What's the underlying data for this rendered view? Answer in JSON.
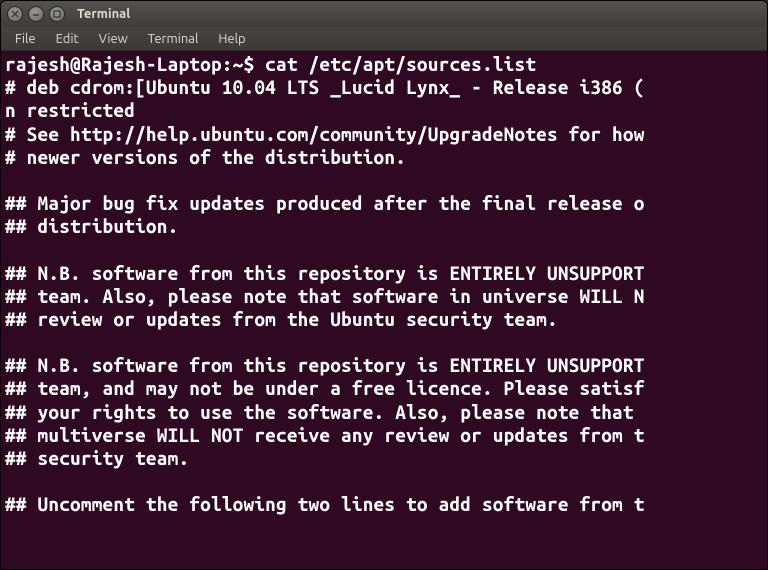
{
  "window": {
    "title": "Terminal"
  },
  "menubar": {
    "items": [
      "File",
      "Edit",
      "View",
      "Terminal",
      "Help"
    ]
  },
  "terminal": {
    "prompt": "rajesh@Rajesh-Laptop:~$ ",
    "command": "cat /etc/apt/sources.list",
    "output_lines": [
      "# deb cdrom:[Ubuntu 10.04 LTS _Lucid Lynx_ - Release i386 (",
      "n restricted",
      "# See http://help.ubuntu.com/community/UpgradeNotes for how",
      "# newer versions of the distribution.",
      "",
      "## Major bug fix updates produced after the final release o",
      "## distribution.",
      "",
      "## N.B. software from this repository is ENTIRELY UNSUPPORT",
      "## team. Also, please note that software in universe WILL N",
      "## review or updates from the Ubuntu security team.",
      "",
      "## N.B. software from this repository is ENTIRELY UNSUPPORT",
      "## team, and may not be under a free licence. Please satisf",
      "## your rights to use the software. Also, please note that ",
      "## multiverse WILL NOT receive any review or updates from t",
      "## security team.",
      "",
      "## Uncomment the following two lines to add software from t"
    ]
  }
}
